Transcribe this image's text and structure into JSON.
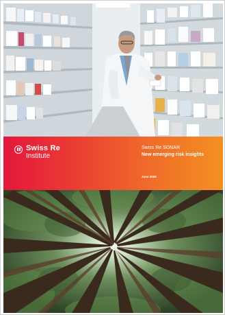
{
  "cover": {
    "logo": {
      "brand": "Swiss Re",
      "sub": "Institute"
    },
    "series": "Swiss Re SONAR",
    "headline": "New emerging risk insights",
    "date": "June 2020"
  },
  "images": {
    "top": "pharmacist-inspecting-medicine-shelves",
    "bottom": "forest-canopy-looking-up"
  },
  "colors": {
    "band_start": "#e4173c",
    "band_end": "#f39022"
  }
}
